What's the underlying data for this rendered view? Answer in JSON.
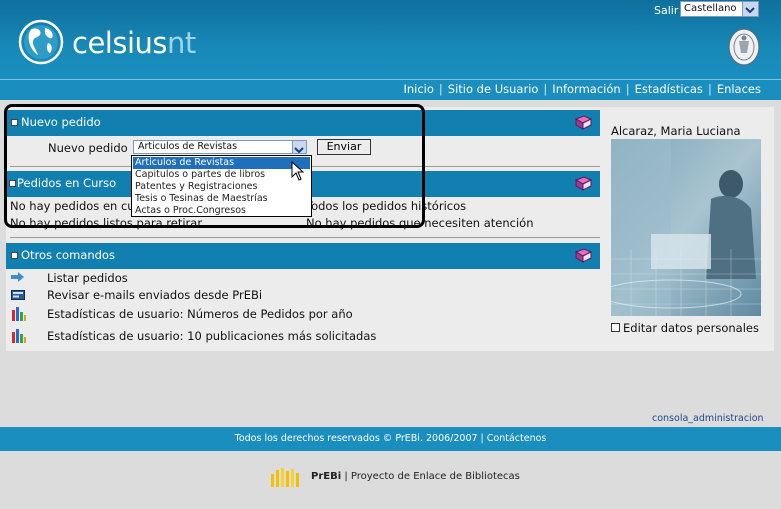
{
  "header": {
    "logo_main": "celsius",
    "logo_suffix": "nt",
    "salir_label": "Salir",
    "language_selected": "Castellano"
  },
  "nav": {
    "items": [
      "Inicio",
      "Sitio de Usuario",
      "Información",
      "Estadísticas",
      "Enlaces"
    ]
  },
  "nuevo_pedido": {
    "title": "Nuevo pedido",
    "label": "Nuevo pedido",
    "selected": "Articulos de Revistas",
    "submit": "Enviar",
    "options": [
      "Articulos de Revistas",
      "Capitulos o partes de libros",
      "Patentes y Registraciones",
      "Tesis o Tesinas de Maestrías",
      "Actas o Proc.Congresos"
    ]
  },
  "pedidos_en_curso": {
    "title": "Pedidos en Curso",
    "left_line1": "No hay pedidos en cu",
    "right_line1": "Todos los pedidos históricos",
    "left_line2": "No hay pedidos listos para retirar",
    "right_line2": "No hay pedidos que necesiten atención"
  },
  "otros_comandos": {
    "title": "Otros comandos",
    "items": [
      {
        "label": "Listar pedidos",
        "icon": "arrow-right-icon"
      },
      {
        "label": "Revisar e-mails enviados desde PrEBi",
        "icon": "email-icon"
      },
      {
        "label": "Estadísticas de usuario: Números de Pedidos por año",
        "icon": "bar-chart-icon"
      },
      {
        "label": "Estadísticas de usuario: 10 publicaciones más solicitadas",
        "icon": "bar-chart-icon"
      }
    ]
  },
  "user": {
    "name": "Alcaraz, Maria Luciana",
    "edit_label": "Editar datos personales"
  },
  "admin_link": "consola_administracion",
  "footer": {
    "copyright_prefix": "Todos los derechos reservados © PrEBi. 2006/2007 | ",
    "contact": "Contáctenos",
    "brand": "PrEBi",
    "tagline": " | Proyecto de Enlace de Bibliotecas"
  },
  "colors": {
    "header_blue": "#1789b8",
    "section_blue": "#1180b1",
    "selection_blue": "#1f6fbd"
  }
}
